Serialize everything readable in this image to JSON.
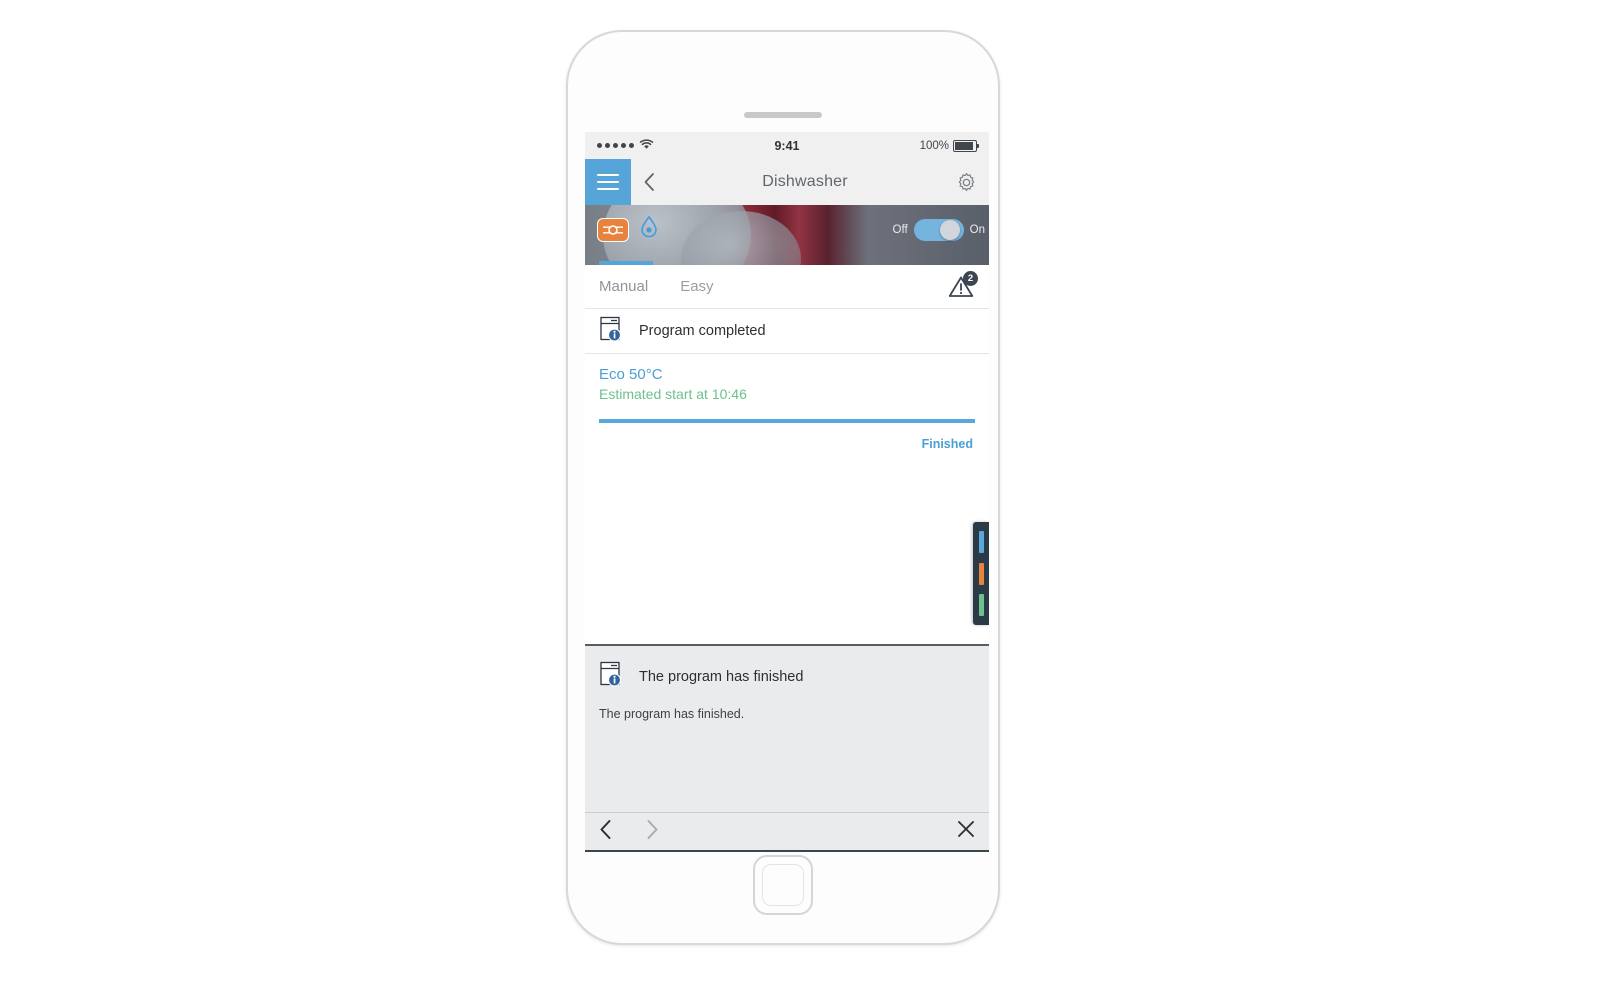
{
  "status_bar": {
    "signal_dots": 5,
    "wifi_icon": "wifi-icon",
    "time": "9:41",
    "battery_percent": "100%"
  },
  "nav": {
    "menu_icon": "hamburger-icon",
    "back_icon": "chevron-left-icon",
    "title": "Dishwasher",
    "settings_icon": "gear-icon"
  },
  "hero": {
    "program_icon": "program-badge-icon",
    "water_icon": "water-drop-icon",
    "off_label": "Off",
    "on_label": "On",
    "toggle_state": "On",
    "toggle_color": "#74b4de"
  },
  "tabs": {
    "items": [
      {
        "label": "Manual",
        "active": true
      },
      {
        "label": "Easy",
        "active": false
      }
    ],
    "warning_icon": "warning-triangle-icon",
    "warning_count": "2"
  },
  "status_row": {
    "icon": "dishwasher-info-icon",
    "text": "Program completed"
  },
  "program": {
    "name": "Eco 50°C",
    "name_color": "#4a9fd4",
    "subtitle": "Estimated start at 10:46",
    "subtitle_color": "#6fc08d",
    "progress_percent": 100,
    "progress_color": "#5aa7db",
    "state_label": "Finished",
    "state_color": "#4a9fd4"
  },
  "side_tab": {
    "name": "color-strip-handle",
    "background": "#2b3a47",
    "segments": [
      "#5aa7db",
      "#e8833f",
      "#6fc08d"
    ]
  },
  "notification": {
    "icon": "dishwasher-info-icon",
    "title": "The program has finished",
    "body": "The program has finished."
  },
  "bottom_bar": {
    "prev_icon": "chevron-left-icon",
    "next_icon": "chevron-right-icon",
    "close_icon": "close-x-icon"
  },
  "task_strip": {
    "icon": "dishwasher-info-icon"
  }
}
